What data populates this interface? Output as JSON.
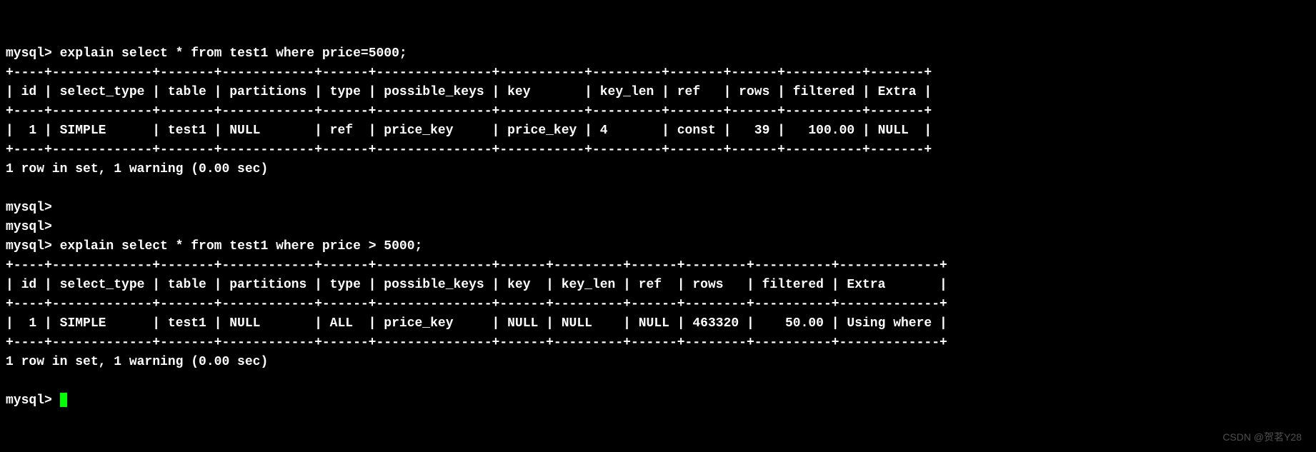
{
  "prompt": "mysql>",
  "query1": {
    "command": "explain select * from test1 where price=5000;",
    "border_top": "+----+-------------+-------+------------+------+---------------+-----------+---------+-------+------+----------+-------+",
    "header": "| id | select_type | table | partitions | type | possible_keys | key       | key_len | ref   | rows | filtered | Extra |",
    "border_mid": "+----+-------------+-------+------------+------+---------------+-----------+---------+-------+------+----------+-------+",
    "row": "|  1 | SIMPLE      | test1 | NULL       | ref  | price_key     | price_key | 4       | const |   39 |   100.00 | NULL  |",
    "border_bot": "+----+-------------+-------+------------+------+---------------+-----------+---------+-------+------+----------+-------+",
    "status": "1 row in set, 1 warning (0.00 sec)"
  },
  "query2": {
    "command": "explain select * from test1 where price > 5000;",
    "border_top": "+----+-------------+-------+------------+------+---------------+------+---------+------+--------+----------+-------------+",
    "header": "| id | select_type | table | partitions | type | possible_keys | key  | key_len | ref  | rows   | filtered | Extra       |",
    "border_mid": "+----+-------------+-------+------------+------+---------------+------+---------+------+--------+----------+-------------+",
    "row": "|  1 | SIMPLE      | test1 | NULL       | ALL  | price_key     | NULL | NULL    | NULL | 463320 |    50.00 | Using where |",
    "border_bot": "+----+-------------+-------+------------+------+---------------+------+---------+------+--------+----------+-------------+",
    "status": "1 row in set, 1 warning (0.00 sec)"
  },
  "chart_data": {
    "type": "table",
    "tables": [
      {
        "query": "explain select * from test1 where price=5000;",
        "columns": [
          "id",
          "select_type",
          "table",
          "partitions",
          "type",
          "possible_keys",
          "key",
          "key_len",
          "ref",
          "rows",
          "filtered",
          "Extra"
        ],
        "rows": [
          [
            "1",
            "SIMPLE",
            "test1",
            "NULL",
            "ref",
            "price_key",
            "price_key",
            "4",
            "const",
            "39",
            "100.00",
            "NULL"
          ]
        ]
      },
      {
        "query": "explain select * from test1 where price > 5000;",
        "columns": [
          "id",
          "select_type",
          "table",
          "partitions",
          "type",
          "possible_keys",
          "key",
          "key_len",
          "ref",
          "rows",
          "filtered",
          "Extra"
        ],
        "rows": [
          [
            "1",
            "SIMPLE",
            "test1",
            "NULL",
            "ALL",
            "price_key",
            "NULL",
            "NULL",
            "NULL",
            "463320",
            "50.00",
            "Using where"
          ]
        ]
      }
    ]
  },
  "watermark": "CSDN @贺茗Y28"
}
